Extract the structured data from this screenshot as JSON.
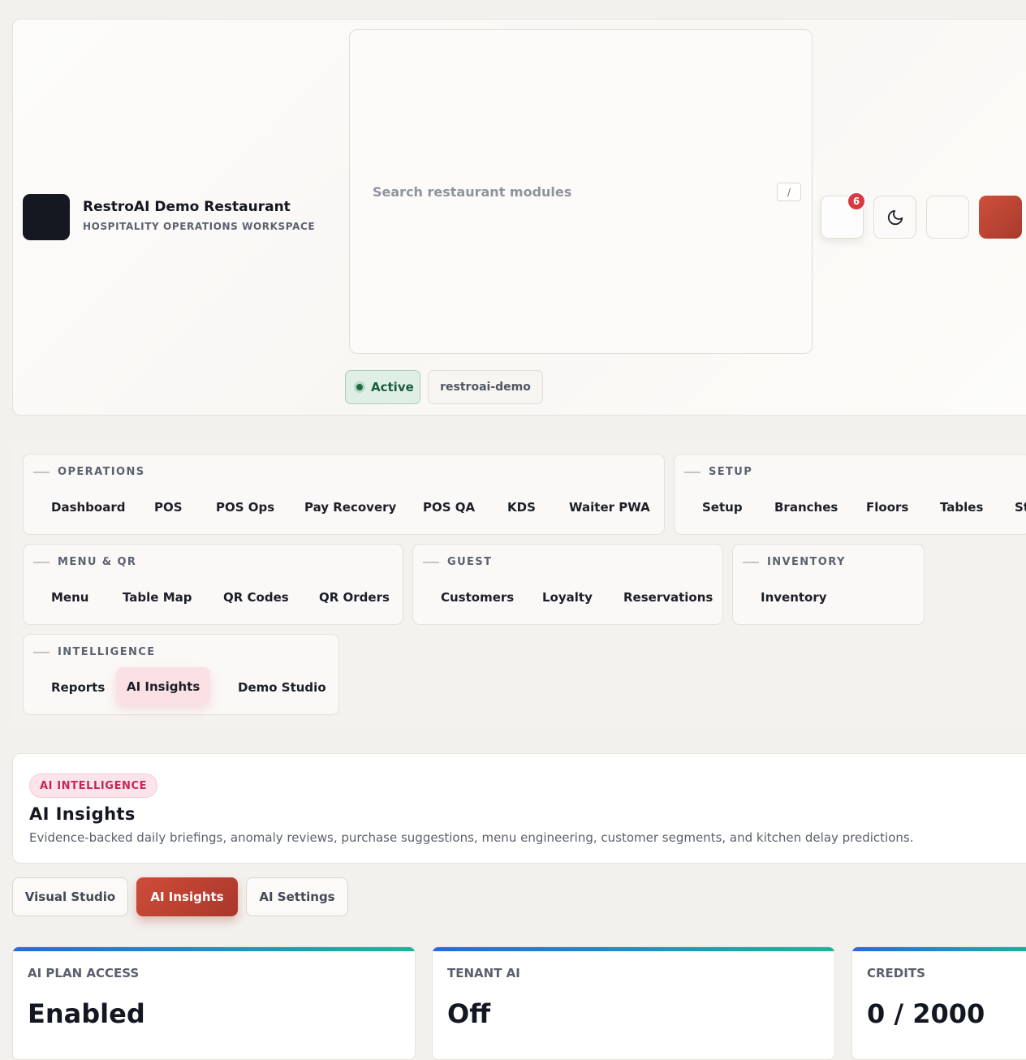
{
  "brand": {
    "name": "RestroAI Demo Restaurant",
    "subtitle": "HOSPITALITY OPERATIONS WORKSPACE"
  },
  "search": {
    "placeholder": "Search restaurant modules",
    "shortcut": "/"
  },
  "header_actions": {
    "notification_count": "6",
    "icons": [
      "bell-icon",
      "moon-icon",
      "settings-icon",
      "avatar"
    ]
  },
  "status": {
    "label": "Active",
    "tenant": "restroai-demo",
    "color": "#1b6e46"
  },
  "nav": {
    "operations": {
      "title": "OPERATIONS",
      "items": [
        "Dashboard",
        "POS",
        "POS Ops",
        "Pay Recovery",
        "POS QA",
        "KDS",
        "Waiter PWA"
      ]
    },
    "setup": {
      "title": "SETUP",
      "items": [
        "Setup",
        "Branches",
        "Floors",
        "Tables",
        "St"
      ]
    },
    "menu_qr": {
      "title": "MENU & QR",
      "items": [
        "Menu",
        "Table Map",
        "QR Codes",
        "QR Orders"
      ]
    },
    "guest": {
      "title": "GUEST",
      "items": [
        "Customers",
        "Loyalty",
        "Reservations"
      ]
    },
    "inventory": {
      "title": "INVENTORY",
      "items": [
        "Inventory"
      ]
    },
    "intelligence": {
      "title": "INTELLIGENCE",
      "items": [
        "Reports",
        "AI Insights",
        "Demo Studio"
      ],
      "active": "AI Insights"
    }
  },
  "page": {
    "eyebrow": "AI INTELLIGENCE",
    "title": "AI Insights",
    "description": "Evidence-backed daily briefings, anomaly reviews, purchase suggestions, menu engineering, customer segments, and kitchen delay predictions."
  },
  "tabs": [
    "Visual Studio",
    "AI Insights",
    "AI Settings"
  ],
  "active_tab": "AI Insights",
  "metrics": [
    {
      "label": "AI PLAN ACCESS",
      "value": "Enabled"
    },
    {
      "label": "TENANT AI",
      "value": "Off"
    },
    {
      "label": "CREDITS",
      "value": "0 / 2000"
    }
  ],
  "colors": {
    "accent": "#c14332",
    "badge": "#d83a3f",
    "eyebrow": "#c4275a",
    "metric_bar_start": "#2f67d8",
    "metric_bar_end": "#1fb39a"
  }
}
